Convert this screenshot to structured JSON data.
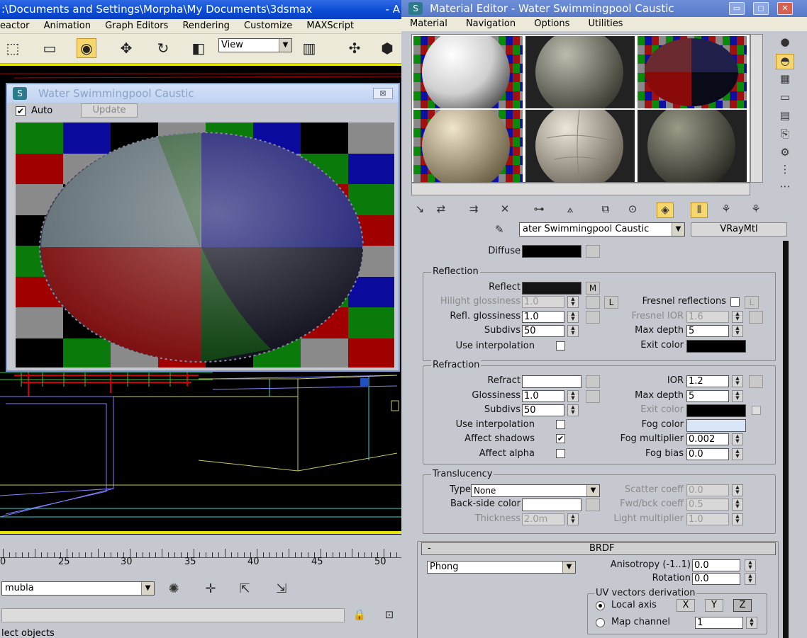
{
  "max": {
    "title": ":\\Documents and Settings\\Morpha\\My Documents\\3dsmax",
    "title_right": "- A",
    "menu": [
      "eactor",
      "Animation",
      "Graph Editors",
      "Rendering",
      "Customize",
      "MAXScript"
    ],
    "toolbar": {
      "view_select": "View"
    },
    "timeline_labels": [
      "0",
      "25",
      "30",
      "35",
      "40",
      "45",
      "50"
    ],
    "selection_set": "mubla",
    "status": "lect objects"
  },
  "render_window": {
    "title": "Water Swimmingpool Caustic",
    "auto_label": "Auto",
    "auto_checked": true,
    "update_label": "Update",
    "close_label": "⊠"
  },
  "mat_editor": {
    "title": "Material Editor - Water Swimmingpool Caustic",
    "menu": [
      "Material",
      "Navigation",
      "Options",
      "Utilities"
    ],
    "material_name": "ater Swimmingpool Caustic",
    "material_type": "VRayMtl",
    "diffuse_label": "Diffuse",
    "reflection": {
      "group": "Reflection",
      "reflect": "Reflect",
      "reflect_map": "M",
      "hilight_gloss": "Hilight glossiness",
      "hilight_gloss_val": "1.0",
      "l_btn": "L",
      "fresnel": "Fresnel reflections",
      "fresnel_l": "L",
      "refl_gloss": "Refl. glossiness",
      "refl_gloss_val": "1.0",
      "fresnel_ior": "Fresnel IOR",
      "fresnel_ior_val": "1.6",
      "subdivs": "Subdivs",
      "subdivs_val": "50",
      "max_depth": "Max depth",
      "max_depth_val": "5",
      "use_interp": "Use interpolation",
      "exit_color": "Exit color"
    },
    "refraction": {
      "group": "Refraction",
      "refract": "Refract",
      "ior": "IOR",
      "ior_val": "1.2",
      "glossiness": "Glossiness",
      "glossiness_val": "1.0",
      "max_depth": "Max depth",
      "max_depth_val": "5",
      "subdivs": "Subdivs",
      "subdivs_val": "50",
      "exit_color": "Exit color",
      "use_interp": "Use interpolation",
      "fog_color": "Fog color",
      "affect_shadows": "Affect shadows",
      "fog_mult": "Fog multiplier",
      "fog_mult_val": "0.002",
      "affect_alpha": "Affect alpha",
      "fog_bias": "Fog bias",
      "fog_bias_val": "0.0"
    },
    "translucency": {
      "group": "Translucency",
      "type": "Type",
      "type_val": "None",
      "scatter": "Scatter coeff",
      "scatter_val": "0.0",
      "backside": "Back-side color",
      "fwd": "Fwd/bck coeff",
      "fwd_val": "0.5",
      "thickness": "Thickness",
      "thickness_val": "2.0m",
      "light_mult": "Light multiplier",
      "light_mult_val": "1.0"
    },
    "brdf": {
      "rollout": "BRDF",
      "collapse": "-",
      "type_val": "Phong",
      "aniso": "Anisotropy (-1..1)",
      "aniso_val": "0.0",
      "rotation": "Rotation",
      "rotation_val": "0.0",
      "uv_group": "UV vectors derivation",
      "local_axis": "Local axis",
      "x": "X",
      "y": "Y",
      "z": "Z",
      "map_channel": "Map channel",
      "map_channel_val": "1"
    }
  },
  "colors": {
    "title_blue": "#0a4bd6",
    "me_title_blue": "#5779c8",
    "active_yellow": "#f5d76e",
    "fog_color": "#d8e6f8"
  }
}
